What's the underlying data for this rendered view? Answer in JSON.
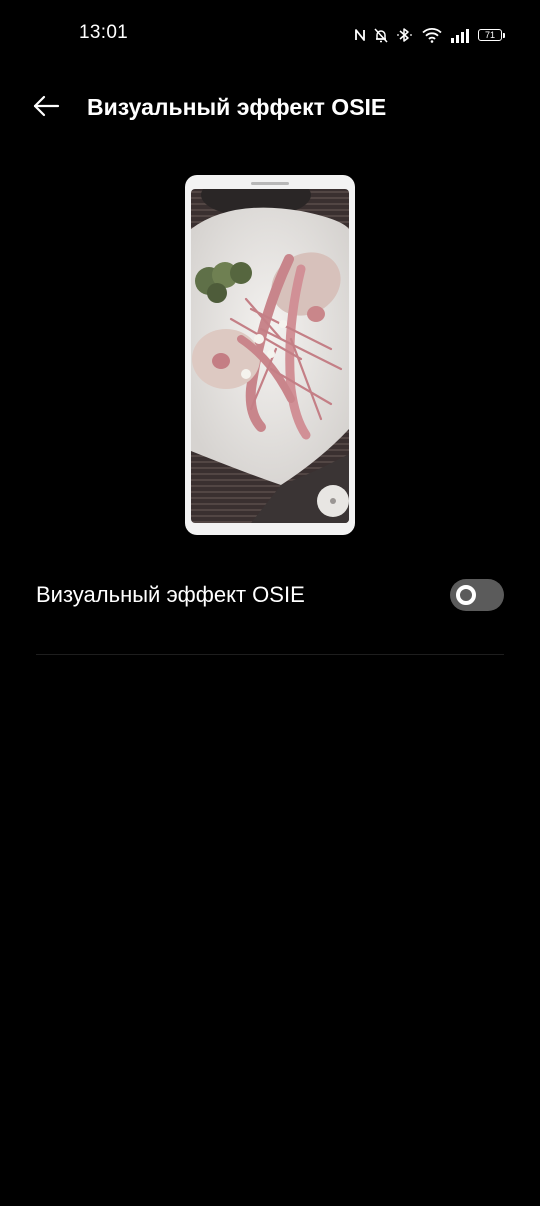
{
  "status_bar": {
    "time": "13:01",
    "battery_level": "71",
    "icons": [
      "nfc-icon",
      "notifications-muted-icon",
      "bluetooth-icon",
      "wifi-icon",
      "cellular-signal-icon",
      "battery-icon"
    ]
  },
  "header": {
    "back_icon": "back-arrow-icon",
    "title": "Визуальный эффект OSIE"
  },
  "preview": {
    "image_subject": "lobster-dish-photo"
  },
  "setting": {
    "label": "Визуальный эффект OSIE",
    "enabled": false
  },
  "colors": {
    "background": "#000000",
    "text": "#ffffff",
    "toggle_off_track": "#5b5b5b",
    "divider": "#1e1e1e"
  }
}
